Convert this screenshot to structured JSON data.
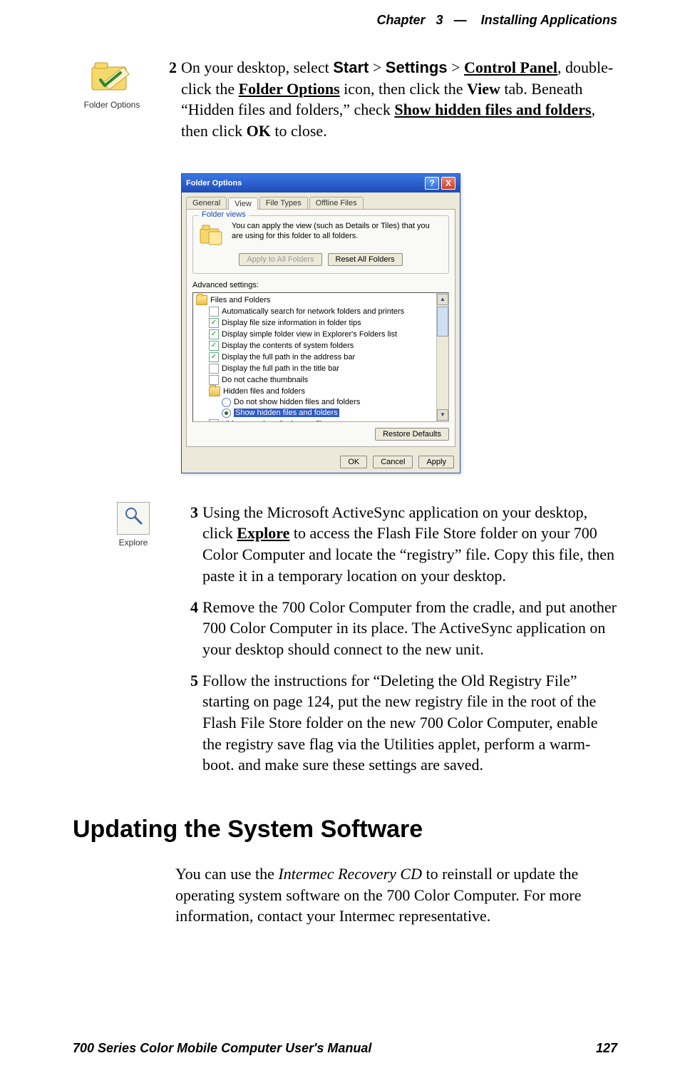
{
  "header": {
    "chapter_label": "Chapter",
    "chapter_number": "3",
    "separator": "—",
    "chapter_title": "Installing Applications"
  },
  "footer": {
    "manual_title": "700 Series Color Mobile Computer User's Manual",
    "page_number": "127"
  },
  "icons": {
    "folder_options_label": "Folder Options",
    "explore_label": "Explore"
  },
  "steps": {
    "s2_num": "2",
    "s2_segments": [
      "On your desktop, select ",
      "Start",
      " > ",
      "Settings",
      " > ",
      "Control Panel",
      ", double-click the ",
      "Folder Options",
      " icon, then click the ",
      "View",
      " tab. Beneath “Hidden files and folders,” check ",
      "Show hidden files and folders",
      ", then click ",
      "OK",
      " to close."
    ],
    "s3_num": "3",
    "s3_segments": [
      "Using the Microsoft ActiveSync application on your desktop, click ",
      "Explore",
      " to access the Flash File Store folder on your 700 Color Computer and locate the “registry” file. Copy this file, then paste it in a temporary location on your desktop."
    ],
    "s4_num": "4",
    "s4_text": "Remove the 700 Color Computer from the cradle, and put another 700 Color Computer in its place. The ActiveSync application on your desktop should connect to the new unit.",
    "s5_num": "5",
    "s5_text": "Follow the instructions for “Deleting the Old Registry File” starting on page 124, put the new registry file in the root of the Flash File Store folder on the new 700 Color Computer, enable the registry save flag via the Utilities applet, perform a warm-boot. and make sure these settings are saved."
  },
  "section_heading": "Updating the System Software",
  "body": {
    "p1_a": "You can use the ",
    "p1_i": "Intermec Recovery CD",
    "p1_b": " to reinstall or update the operating system software on the 700 Color Computer. For more information, contact your Intermec representative."
  },
  "dialog": {
    "title": "Folder Options",
    "tabs": [
      "General",
      "View",
      "File Types",
      "Offline Files"
    ],
    "active_tab_index": 1,
    "folder_views": {
      "legend": "Folder views",
      "text": "You can apply the view (such as Details or Tiles) that you are using for this folder to all folders.",
      "btn_apply_all": "Apply to All Folders",
      "btn_reset_all": "Reset All Folders"
    },
    "advanced_label": "Advanced settings:",
    "tree": {
      "root_label": "Files and Folders",
      "items": [
        {
          "type": "checkbox",
          "checked": false,
          "label": "Automatically search for network folders and printers"
        },
        {
          "type": "checkbox",
          "checked": true,
          "label": "Display file size information in folder tips"
        },
        {
          "type": "checkbox",
          "checked": true,
          "label": "Display simple folder view in Explorer's Folders list"
        },
        {
          "type": "checkbox",
          "checked": true,
          "label": "Display the contents of system folders"
        },
        {
          "type": "checkbox",
          "checked": true,
          "label": "Display the full path in the address bar"
        },
        {
          "type": "checkbox",
          "checked": false,
          "label": "Display the full path in the title bar"
        },
        {
          "type": "checkbox",
          "checked": false,
          "label": "Do not cache thumbnails"
        }
      ],
      "hidden_group": {
        "label": "Hidden files and folders",
        "options": [
          {
            "checked": false,
            "label": "Do not show hidden files and folders"
          },
          {
            "checked": true,
            "label": "Show hidden files and folders"
          }
        ]
      },
      "last_item": {
        "type": "checkbox",
        "checked": false,
        "label": "Hide extensions for known file types"
      }
    },
    "restore_defaults": "Restore Defaults",
    "ok": "OK",
    "cancel": "Cancel",
    "apply": "Apply",
    "help_symbol": "?",
    "close_symbol": "X"
  }
}
